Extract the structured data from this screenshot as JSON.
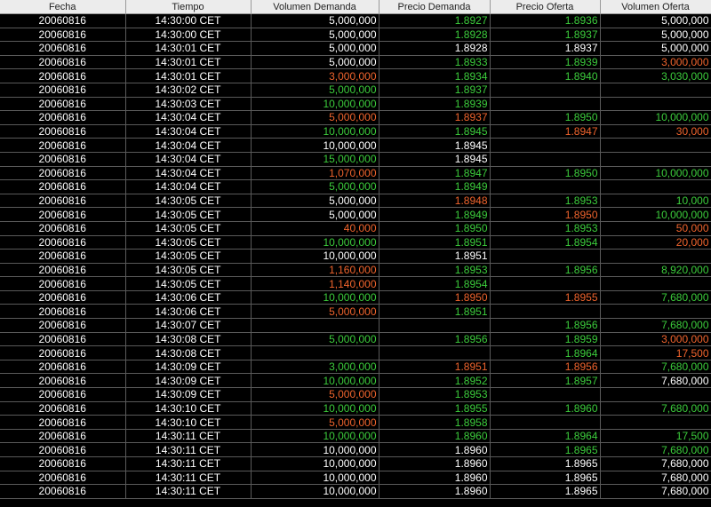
{
  "colors": {
    "white": "#ffffff",
    "green": "#3ccd3c",
    "orange": "#f0642d",
    "background": "#000000",
    "header_bg": "#ececec"
  },
  "table": {
    "headers": [
      "Fecha",
      "Tiempo",
      "Volumen Demanda",
      "Precio Demanda",
      "Precio Oferta",
      "Volumen Oferta"
    ],
    "rows": [
      [
        [
          "20060816",
          "w"
        ],
        [
          "14:30:00 CET",
          "w"
        ],
        [
          "5,000,000",
          "w"
        ],
        [
          "1.8927",
          "g"
        ],
        [
          "1.8936",
          "g"
        ],
        [
          "5,000,000",
          "w"
        ]
      ],
      [
        [
          "20060816",
          "w"
        ],
        [
          "14:30:00 CET",
          "w"
        ],
        [
          "5,000,000",
          "w"
        ],
        [
          "1.8928",
          "g"
        ],
        [
          "1.8937",
          "g"
        ],
        [
          "5,000,000",
          "w"
        ]
      ],
      [
        [
          "20060816",
          "w"
        ],
        [
          "14:30:01 CET",
          "w"
        ],
        [
          "5,000,000",
          "w"
        ],
        [
          "1.8928",
          "w"
        ],
        [
          "1.8937",
          "w"
        ],
        [
          "5,000,000",
          "w"
        ]
      ],
      [
        [
          "20060816",
          "w"
        ],
        [
          "14:30:01 CET",
          "w"
        ],
        [
          "5,000,000",
          "w"
        ],
        [
          "1.8933",
          "g"
        ],
        [
          "1.8939",
          "g"
        ],
        [
          "3,000,000",
          "o"
        ]
      ],
      [
        [
          "20060816",
          "w"
        ],
        [
          "14:30:01 CET",
          "w"
        ],
        [
          "3,000,000",
          "o"
        ],
        [
          "1.8934",
          "g"
        ],
        [
          "1.8940",
          "g"
        ],
        [
          "3,030,000",
          "g"
        ]
      ],
      [
        [
          "20060816",
          "w"
        ],
        [
          "14:30:02 CET",
          "w"
        ],
        [
          "5,000,000",
          "g"
        ],
        [
          "1.8937",
          "g"
        ],
        [
          "",
          ""
        ],
        [
          "",
          ""
        ]
      ],
      [
        [
          "20060816",
          "w"
        ],
        [
          "14:30:03 CET",
          "w"
        ],
        [
          "10,000,000",
          "g"
        ],
        [
          "1.8939",
          "g"
        ],
        [
          "",
          ""
        ],
        [
          "",
          ""
        ]
      ],
      [
        [
          "20060816",
          "w"
        ],
        [
          "14:30:04 CET",
          "w"
        ],
        [
          "5,000,000",
          "o"
        ],
        [
          "1.8937",
          "o"
        ],
        [
          "1.8950",
          "g"
        ],
        [
          "10,000,000",
          "g"
        ]
      ],
      [
        [
          "20060816",
          "w"
        ],
        [
          "14:30:04 CET",
          "w"
        ],
        [
          "10,000,000",
          "g"
        ],
        [
          "1.8945",
          "g"
        ],
        [
          "1.8947",
          "o"
        ],
        [
          "30,000",
          "o"
        ]
      ],
      [
        [
          "20060816",
          "w"
        ],
        [
          "14:30:04 CET",
          "w"
        ],
        [
          "10,000,000",
          "w"
        ],
        [
          "1.8945",
          "w"
        ],
        [
          "",
          ""
        ],
        [
          "",
          ""
        ]
      ],
      [
        [
          "20060816",
          "w"
        ],
        [
          "14:30:04 CET",
          "w"
        ],
        [
          "15,000,000",
          "g"
        ],
        [
          "1.8945",
          "w"
        ],
        [
          "",
          ""
        ],
        [
          "",
          ""
        ]
      ],
      [
        [
          "20060816",
          "w"
        ],
        [
          "14:30:04 CET",
          "w"
        ],
        [
          "1,070,000",
          "o"
        ],
        [
          "1.8947",
          "g"
        ],
        [
          "1.8950",
          "g"
        ],
        [
          "10,000,000",
          "g"
        ]
      ],
      [
        [
          "20060816",
          "w"
        ],
        [
          "14:30:04 CET",
          "w"
        ],
        [
          "5,000,000",
          "g"
        ],
        [
          "1.8949",
          "g"
        ],
        [
          "",
          ""
        ],
        [
          "",
          ""
        ]
      ],
      [
        [
          "20060816",
          "w"
        ],
        [
          "14:30:05 CET",
          "w"
        ],
        [
          "5,000,000",
          "w"
        ],
        [
          "1.8948",
          "o"
        ],
        [
          "1.8953",
          "g"
        ],
        [
          "10,000",
          "g"
        ]
      ],
      [
        [
          "20060816",
          "w"
        ],
        [
          "14:30:05 CET",
          "w"
        ],
        [
          "5,000,000",
          "w"
        ],
        [
          "1.8949",
          "g"
        ],
        [
          "1.8950",
          "o"
        ],
        [
          "10,000,000",
          "g"
        ]
      ],
      [
        [
          "20060816",
          "w"
        ],
        [
          "14:30:05 CET",
          "w"
        ],
        [
          "40,000",
          "o"
        ],
        [
          "1.8950",
          "g"
        ],
        [
          "1.8953",
          "g"
        ],
        [
          "50,000",
          "o"
        ]
      ],
      [
        [
          "20060816",
          "w"
        ],
        [
          "14:30:05 CET",
          "w"
        ],
        [
          "10,000,000",
          "g"
        ],
        [
          "1.8951",
          "g"
        ],
        [
          "1.8954",
          "g"
        ],
        [
          "20,000",
          "o"
        ]
      ],
      [
        [
          "20060816",
          "w"
        ],
        [
          "14:30:05 CET",
          "w"
        ],
        [
          "10,000,000",
          "w"
        ],
        [
          "1.8951",
          "w"
        ],
        [
          "",
          ""
        ],
        [
          "",
          ""
        ]
      ],
      [
        [
          "20060816",
          "w"
        ],
        [
          "14:30:05 CET",
          "w"
        ],
        [
          "1,160,000",
          "o"
        ],
        [
          "1.8953",
          "g"
        ],
        [
          "1.8956",
          "g"
        ],
        [
          "8,920,000",
          "g"
        ]
      ],
      [
        [
          "20060816",
          "w"
        ],
        [
          "14:30:05 CET",
          "w"
        ],
        [
          "1,140,000",
          "o"
        ],
        [
          "1.8954",
          "g"
        ],
        [
          "",
          ""
        ],
        [
          "",
          ""
        ]
      ],
      [
        [
          "20060816",
          "w"
        ],
        [
          "14:30:06 CET",
          "w"
        ],
        [
          "10,000,000",
          "g"
        ],
        [
          "1.8950",
          "o"
        ],
        [
          "1.8955",
          "o"
        ],
        [
          "7,680,000",
          "g"
        ]
      ],
      [
        [
          "20060816",
          "w"
        ],
        [
          "14:30:06 CET",
          "w"
        ],
        [
          "5,000,000",
          "o"
        ],
        [
          "1.8951",
          "g"
        ],
        [
          "",
          ""
        ],
        [
          "",
          ""
        ]
      ],
      [
        [
          "20060816",
          "w"
        ],
        [
          "14:30:07 CET",
          "w"
        ],
        [
          "",
          ""
        ],
        [
          "",
          ""
        ],
        [
          "1.8956",
          "g"
        ],
        [
          "7,680,000",
          "g"
        ]
      ],
      [
        [
          "20060816",
          "w"
        ],
        [
          "14:30:08 CET",
          "w"
        ],
        [
          "5,000,000",
          "g"
        ],
        [
          "1.8956",
          "g"
        ],
        [
          "1.8959",
          "g"
        ],
        [
          "3,000,000",
          "o"
        ]
      ],
      [
        [
          "20060816",
          "w"
        ],
        [
          "14:30:08 CET",
          "w"
        ],
        [
          "",
          ""
        ],
        [
          "",
          ""
        ],
        [
          "1.8964",
          "g"
        ],
        [
          "17,500",
          "o"
        ]
      ],
      [
        [
          "20060816",
          "w"
        ],
        [
          "14:30:09 CET",
          "w"
        ],
        [
          "3,000,000",
          "g"
        ],
        [
          "1.8951",
          "o"
        ],
        [
          "1.8956",
          "o"
        ],
        [
          "7,680,000",
          "g"
        ]
      ],
      [
        [
          "20060816",
          "w"
        ],
        [
          "14:30:09 CET",
          "w"
        ],
        [
          "10,000,000",
          "g"
        ],
        [
          "1.8952",
          "g"
        ],
        [
          "1.8957",
          "g"
        ],
        [
          "7,680,000",
          "w"
        ]
      ],
      [
        [
          "20060816",
          "w"
        ],
        [
          "14:30:09 CET",
          "w"
        ],
        [
          "5,000,000",
          "o"
        ],
        [
          "1.8953",
          "g"
        ],
        [
          "",
          ""
        ],
        [
          "",
          ""
        ]
      ],
      [
        [
          "20060816",
          "w"
        ],
        [
          "14:30:10 CET",
          "w"
        ],
        [
          "10,000,000",
          "g"
        ],
        [
          "1.8955",
          "g"
        ],
        [
          "1.8960",
          "g"
        ],
        [
          "7,680,000",
          "g"
        ]
      ],
      [
        [
          "20060816",
          "w"
        ],
        [
          "14:30:10 CET",
          "w"
        ],
        [
          "5,000,000",
          "o"
        ],
        [
          "1.8958",
          "g"
        ],
        [
          "",
          ""
        ],
        [
          "",
          ""
        ]
      ],
      [
        [
          "20060816",
          "w"
        ],
        [
          "14:30:11 CET",
          "w"
        ],
        [
          "10,000,000",
          "g"
        ],
        [
          "1.8960",
          "g"
        ],
        [
          "1.8964",
          "g"
        ],
        [
          "17,500",
          "g"
        ]
      ],
      [
        [
          "20060816",
          "w"
        ],
        [
          "14:30:11 CET",
          "w"
        ],
        [
          "10,000,000",
          "w"
        ],
        [
          "1.8960",
          "w"
        ],
        [
          "1.8965",
          "g"
        ],
        [
          "7,680,000",
          "g"
        ]
      ],
      [
        [
          "20060816",
          "w"
        ],
        [
          "14:30:11 CET",
          "w"
        ],
        [
          "10,000,000",
          "w"
        ],
        [
          "1.8960",
          "w"
        ],
        [
          "1.8965",
          "w"
        ],
        [
          "7,680,000",
          "w"
        ]
      ],
      [
        [
          "20060816",
          "w"
        ],
        [
          "14:30:11 CET",
          "w"
        ],
        [
          "10,000,000",
          "w"
        ],
        [
          "1.8960",
          "w"
        ],
        [
          "1.8965",
          "w"
        ],
        [
          "7,680,000",
          "w"
        ]
      ],
      [
        [
          "20060816",
          "w"
        ],
        [
          "14:30:11 CET",
          "w"
        ],
        [
          "10,000,000",
          "w"
        ],
        [
          "1.8960",
          "w"
        ],
        [
          "1.8965",
          "w"
        ],
        [
          "7,680,000",
          "w"
        ]
      ]
    ]
  }
}
